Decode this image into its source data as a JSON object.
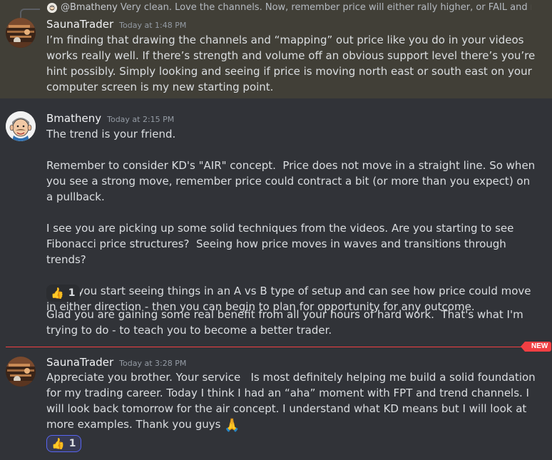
{
  "messages": [
    {
      "author": "SaunaTrader",
      "timestamp": "Today at 1:48 PM",
      "reply": {
        "author": "@Bmatheny",
        "snippet": "Very clean.  Love the channels.  Now, remember price will either rally higher, or FAIL and move ..."
      },
      "paragraphs": [
        "I’m finding that drawing the channels and “mapping” out price like you do in your videos works really well. If there’s strength and volume off an obvious support level there’s you’re hint possibly. Simply looking and seeing if price is moving north east or south east on your computer screen is my new starting point."
      ]
    },
    {
      "author": "Bmatheny",
      "timestamp": "Today at 2:15 PM",
      "paragraphs": [
        "The trend is your friend.",
        "Remember to consider KD's \"AIR\" concept.  Price does not move in a straight line. So when you see a strong move, remember price could contract a bit (or more than you expect) on a pullback.",
        "I see you are picking up some solid techniques from the videos. Are you starting to see Fibonacci price structures?  Seeing how price moves in waves and transitions through trends?",
        "Once you start seeing things in an A vs B type of setup and can see how price could move in either direction - then you can begin to plan for opportunity for any outcome."
      ],
      "reaction": {
        "emoji": "thumbs-up",
        "glyph": "👍",
        "count": "1"
      },
      "followup": "Glad you are gaining some real benefit from all your hours of hard work.  That's what I'm trying to do - to teach you to become a better trader."
    },
    {
      "author": "SaunaTrader",
      "timestamp": "Today at 3:28 PM",
      "paragraphs": [
        "Appreciate you brother. Your service   Is most definitely helping me build a solid foundation for my trading career. Today I think I had an “aha” moment with FPT and trend channels. I will look back tomorrow for the air concept. I understand what KD means but I will look at more examples. Thank you guys"
      ],
      "inline_emoji": {
        "name": "folded-hands",
        "glyph": "🙏"
      },
      "reaction": {
        "emoji": "thumbs-up",
        "glyph": "👍",
        "count": "1"
      }
    }
  ],
  "divider": {
    "label": "NEW"
  },
  "colors": {
    "background": "#313338",
    "highlight": "#413f37",
    "new_divider": "#f23f43",
    "reaction_me_border": "#5865f2"
  }
}
